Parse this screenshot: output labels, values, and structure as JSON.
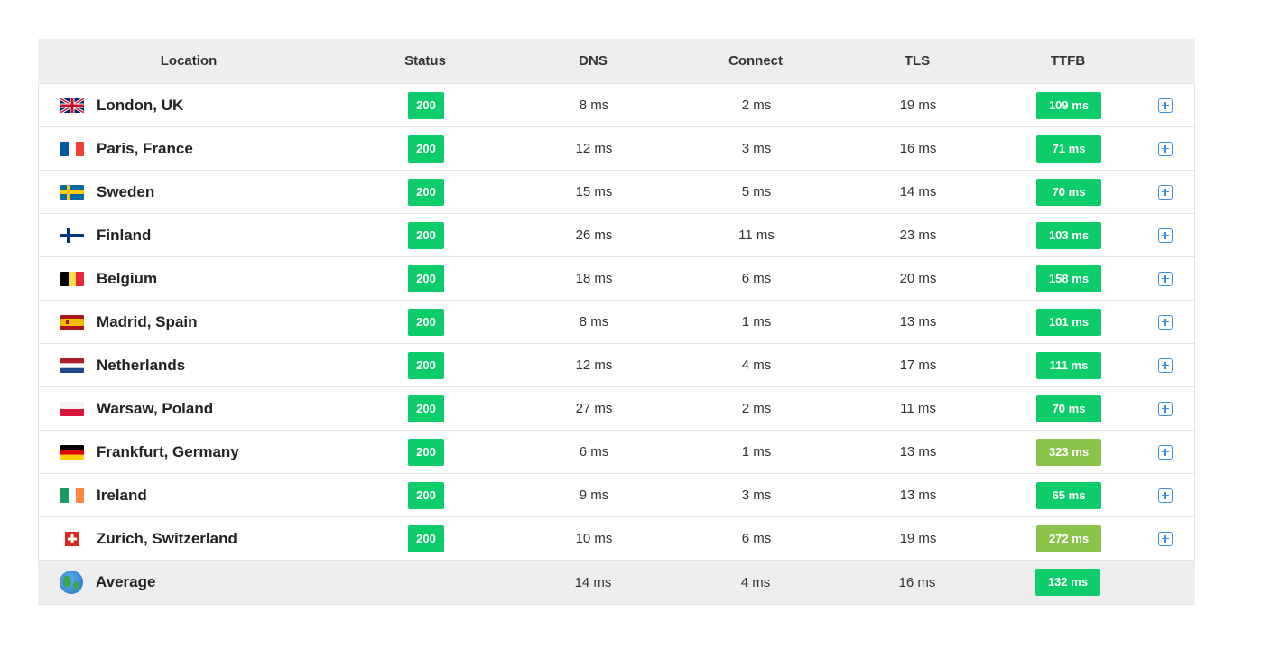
{
  "table": {
    "headers": {
      "location": "Location",
      "status": "Status",
      "dns": "DNS",
      "connect": "Connect",
      "tls": "TLS",
      "ttfb": "TTFB"
    },
    "rows": [
      {
        "location": "London, UK",
        "flag": "uk-flag",
        "status": "200",
        "dns": "8 ms",
        "connect": "2 ms",
        "tls": "19 ms",
        "ttfb": "109 ms",
        "ttfb_color": "#0ccd6a"
      },
      {
        "location": "Paris, France",
        "flag": "france-flag",
        "status": "200",
        "dns": "12 ms",
        "connect": "3 ms",
        "tls": "16 ms",
        "ttfb": "71 ms",
        "ttfb_color": "#0ccd6a"
      },
      {
        "location": "Sweden",
        "flag": "sweden-flag",
        "status": "200",
        "dns": "15 ms",
        "connect": "5 ms",
        "tls": "14 ms",
        "ttfb": "70 ms",
        "ttfb_color": "#0ccd6a"
      },
      {
        "location": "Finland",
        "flag": "finland-flag",
        "status": "200",
        "dns": "26 ms",
        "connect": "11 ms",
        "tls": "23 ms",
        "ttfb": "103 ms",
        "ttfb_color": "#0ccd6a"
      },
      {
        "location": "Belgium",
        "flag": "belgium-flag",
        "status": "200",
        "dns": "18 ms",
        "connect": "6 ms",
        "tls": "20 ms",
        "ttfb": "158 ms",
        "ttfb_color": "#0ccd6a"
      },
      {
        "location": "Madrid, Spain",
        "flag": "spain-flag",
        "status": "200",
        "dns": "8 ms",
        "connect": "1 ms",
        "tls": "13 ms",
        "ttfb": "101 ms",
        "ttfb_color": "#0ccd6a"
      },
      {
        "location": "Netherlands",
        "flag": "netherlands-flag",
        "status": "200",
        "dns": "12 ms",
        "connect": "4 ms",
        "tls": "17 ms",
        "ttfb": "111 ms",
        "ttfb_color": "#0ccd6a"
      },
      {
        "location": "Warsaw, Poland",
        "flag": "poland-flag",
        "status": "200",
        "dns": "27 ms",
        "connect": "2 ms",
        "tls": "11 ms",
        "ttfb": "70 ms",
        "ttfb_color": "#0ccd6a"
      },
      {
        "location": "Frankfurt, Germany",
        "flag": "germany-flag",
        "status": "200",
        "dns": "6 ms",
        "connect": "1 ms",
        "tls": "13 ms",
        "ttfb": "323 ms",
        "ttfb_color": "#8bc34a"
      },
      {
        "location": "Ireland",
        "flag": "ireland-flag",
        "status": "200",
        "dns": "9 ms",
        "connect": "3 ms",
        "tls": "13 ms",
        "ttfb": "65 ms",
        "ttfb_color": "#0ccd6a"
      },
      {
        "location": "Zurich, Switzerland",
        "flag": "switzerland-flag",
        "status": "200",
        "dns": "10 ms",
        "connect": "6 ms",
        "tls": "19 ms",
        "ttfb": "272 ms",
        "ttfb_color": "#8bc34a"
      }
    ],
    "average": {
      "location": "Average",
      "icon": "globe-icon",
      "dns": "14 ms",
      "connect": "4 ms",
      "tls": "16 ms",
      "ttfb": "132 ms",
      "ttfb_color": "#0ccd6a"
    }
  },
  "colors": {
    "ok_green": "#0ccd6a",
    "warn_green": "#8bc34a",
    "action_blue": "#3d8ddb"
  }
}
